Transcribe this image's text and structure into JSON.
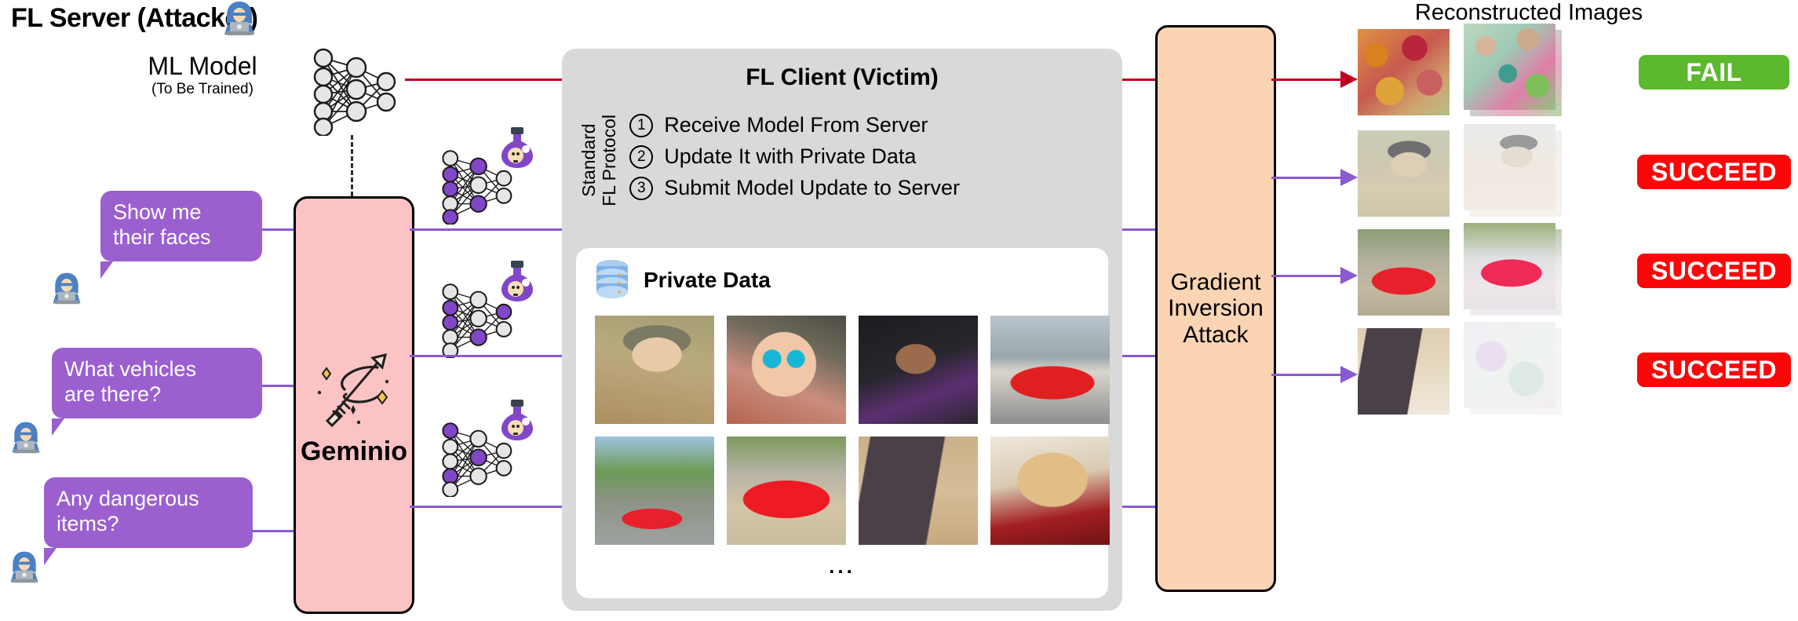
{
  "server": {
    "title": "FL Server (Attacker)",
    "attacker_icon": "hacker-icon",
    "model": {
      "name": "ML Model",
      "sub": "(To Be Trained)",
      "icon": "neural-network-icon"
    }
  },
  "prompts": [
    {
      "id": "faces",
      "text": "Show me\ntheir faces",
      "line1": "Show me",
      "line2": "their faces"
    },
    {
      "id": "vehicles",
      "text": "What vehicles\nare there?",
      "line1": "What vehicles",
      "line2": "are there?"
    },
    {
      "id": "danger",
      "text": "Any dangerous\nitems?",
      "line1": "Any dangerous",
      "line2": "items?"
    }
  ],
  "geminio": {
    "label": "Geminio",
    "icon": "magic-wand-icon"
  },
  "malicious_models": [
    {
      "icon": "neural-network-icon",
      "badge_icon": "poison-flask-icon"
    },
    {
      "icon": "neural-network-icon",
      "badge_icon": "poison-flask-icon"
    },
    {
      "icon": "neural-network-icon",
      "badge_icon": "poison-flask-icon"
    }
  ],
  "client": {
    "title": "FL Client (Victim)",
    "protocol_label_line1": "Standard",
    "protocol_label_line2": "FL Protocol",
    "steps": [
      {
        "num": "1",
        "text": "Receive Model From Server"
      },
      {
        "num": "2",
        "text": "Update It with Private Data"
      },
      {
        "num": "3",
        "text": "Submit Model Update to Server"
      }
    ],
    "private_data": {
      "title": "Private Data",
      "icon": "database-icon",
      "more": "...",
      "thumbnails": [
        {
          "alt": "soldier-with-helmet"
        },
        {
          "alt": "man-with-sunglasses"
        },
        {
          "alt": "graduate-in-cap-and-gown"
        },
        {
          "alt": "red-ferrari-on-street"
        },
        {
          "alt": "red-convertible-in-driveway"
        },
        {
          "alt": "red-coupe-parked"
        },
        {
          "alt": "handgun-on-carpet"
        },
        {
          "alt": "dog-in-holiday-scarf"
        }
      ]
    }
  },
  "attack": {
    "line1": "Gradient",
    "line2": "Inversion",
    "line3": "Attack"
  },
  "reconstruction": {
    "title": "Reconstructed Images",
    "rows": [
      {
        "result": "FAIL",
        "result_color": "#5cb82d",
        "arrow_color": "#c00020",
        "images": [
          {
            "alt": "warm-noise-reconstruction"
          },
          {
            "alt": "cool-noise-reconstruction"
          }
        ]
      },
      {
        "result": "SUCCEED",
        "result_color": "#fa0808",
        "arrow_color": "#8a5ad0",
        "images": [
          {
            "alt": "soldier-reconstruction"
          },
          {
            "alt": "soldier-reconstruction-noisy"
          }
        ]
      },
      {
        "result": "SUCCEED",
        "result_color": "#fa0808",
        "arrow_color": "#8a5ad0",
        "images": [
          {
            "alt": "red-car-reconstruction"
          },
          {
            "alt": "red-car-reconstruction-noisy"
          }
        ]
      },
      {
        "result": "SUCCEED",
        "result_color": "#fa0808",
        "arrow_color": "#8a5ad0",
        "images": [
          {
            "alt": "handgun-reconstruction"
          },
          {
            "alt": "blank-noise-reconstruction"
          }
        ]
      }
    ]
  },
  "colors": {
    "purple": "#8a5ad0",
    "bubble_purple": "#9b5fd0",
    "red_line": "#c00020",
    "geminio_fill": "#fbc3c3",
    "attack_fill": "#fbd4b4",
    "client_fill": "#d9d9d9",
    "fail_green": "#5cb82d",
    "succeed_red": "#fa0808"
  }
}
